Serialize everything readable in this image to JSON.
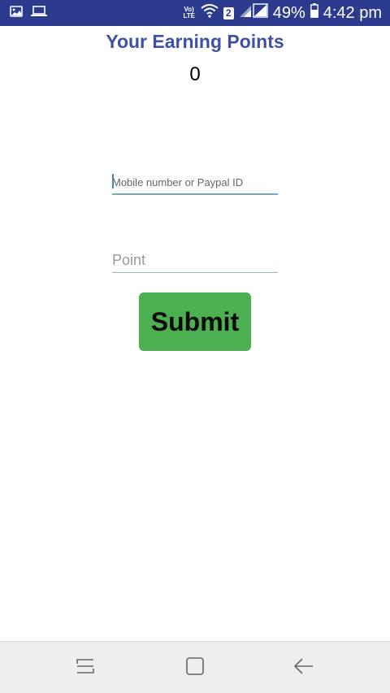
{
  "status_bar": {
    "volte_top": "Vo)",
    "volte_bottom": "LTE",
    "sim_number": "2",
    "battery_percent": "49%",
    "time": "4:42 pm",
    "icons": [
      "gallery-icon",
      "laptop-icon",
      "wifi-icon",
      "signal-icon",
      "battery-icon"
    ],
    "background_color": "#2d3b8f"
  },
  "header": {
    "title": "Your Earning Points",
    "points_value": "0",
    "title_color": "#3f51a5"
  },
  "form": {
    "mobile_placeholder": "Mobile number or Paypal ID",
    "mobile_value": "",
    "point_placeholder": "Point",
    "point_value": "",
    "submit_label": "Submit",
    "submit_color": "#4caf50"
  },
  "nav_bar": {
    "icons": [
      "recent-apps-icon",
      "home-icon",
      "back-icon"
    ]
  }
}
